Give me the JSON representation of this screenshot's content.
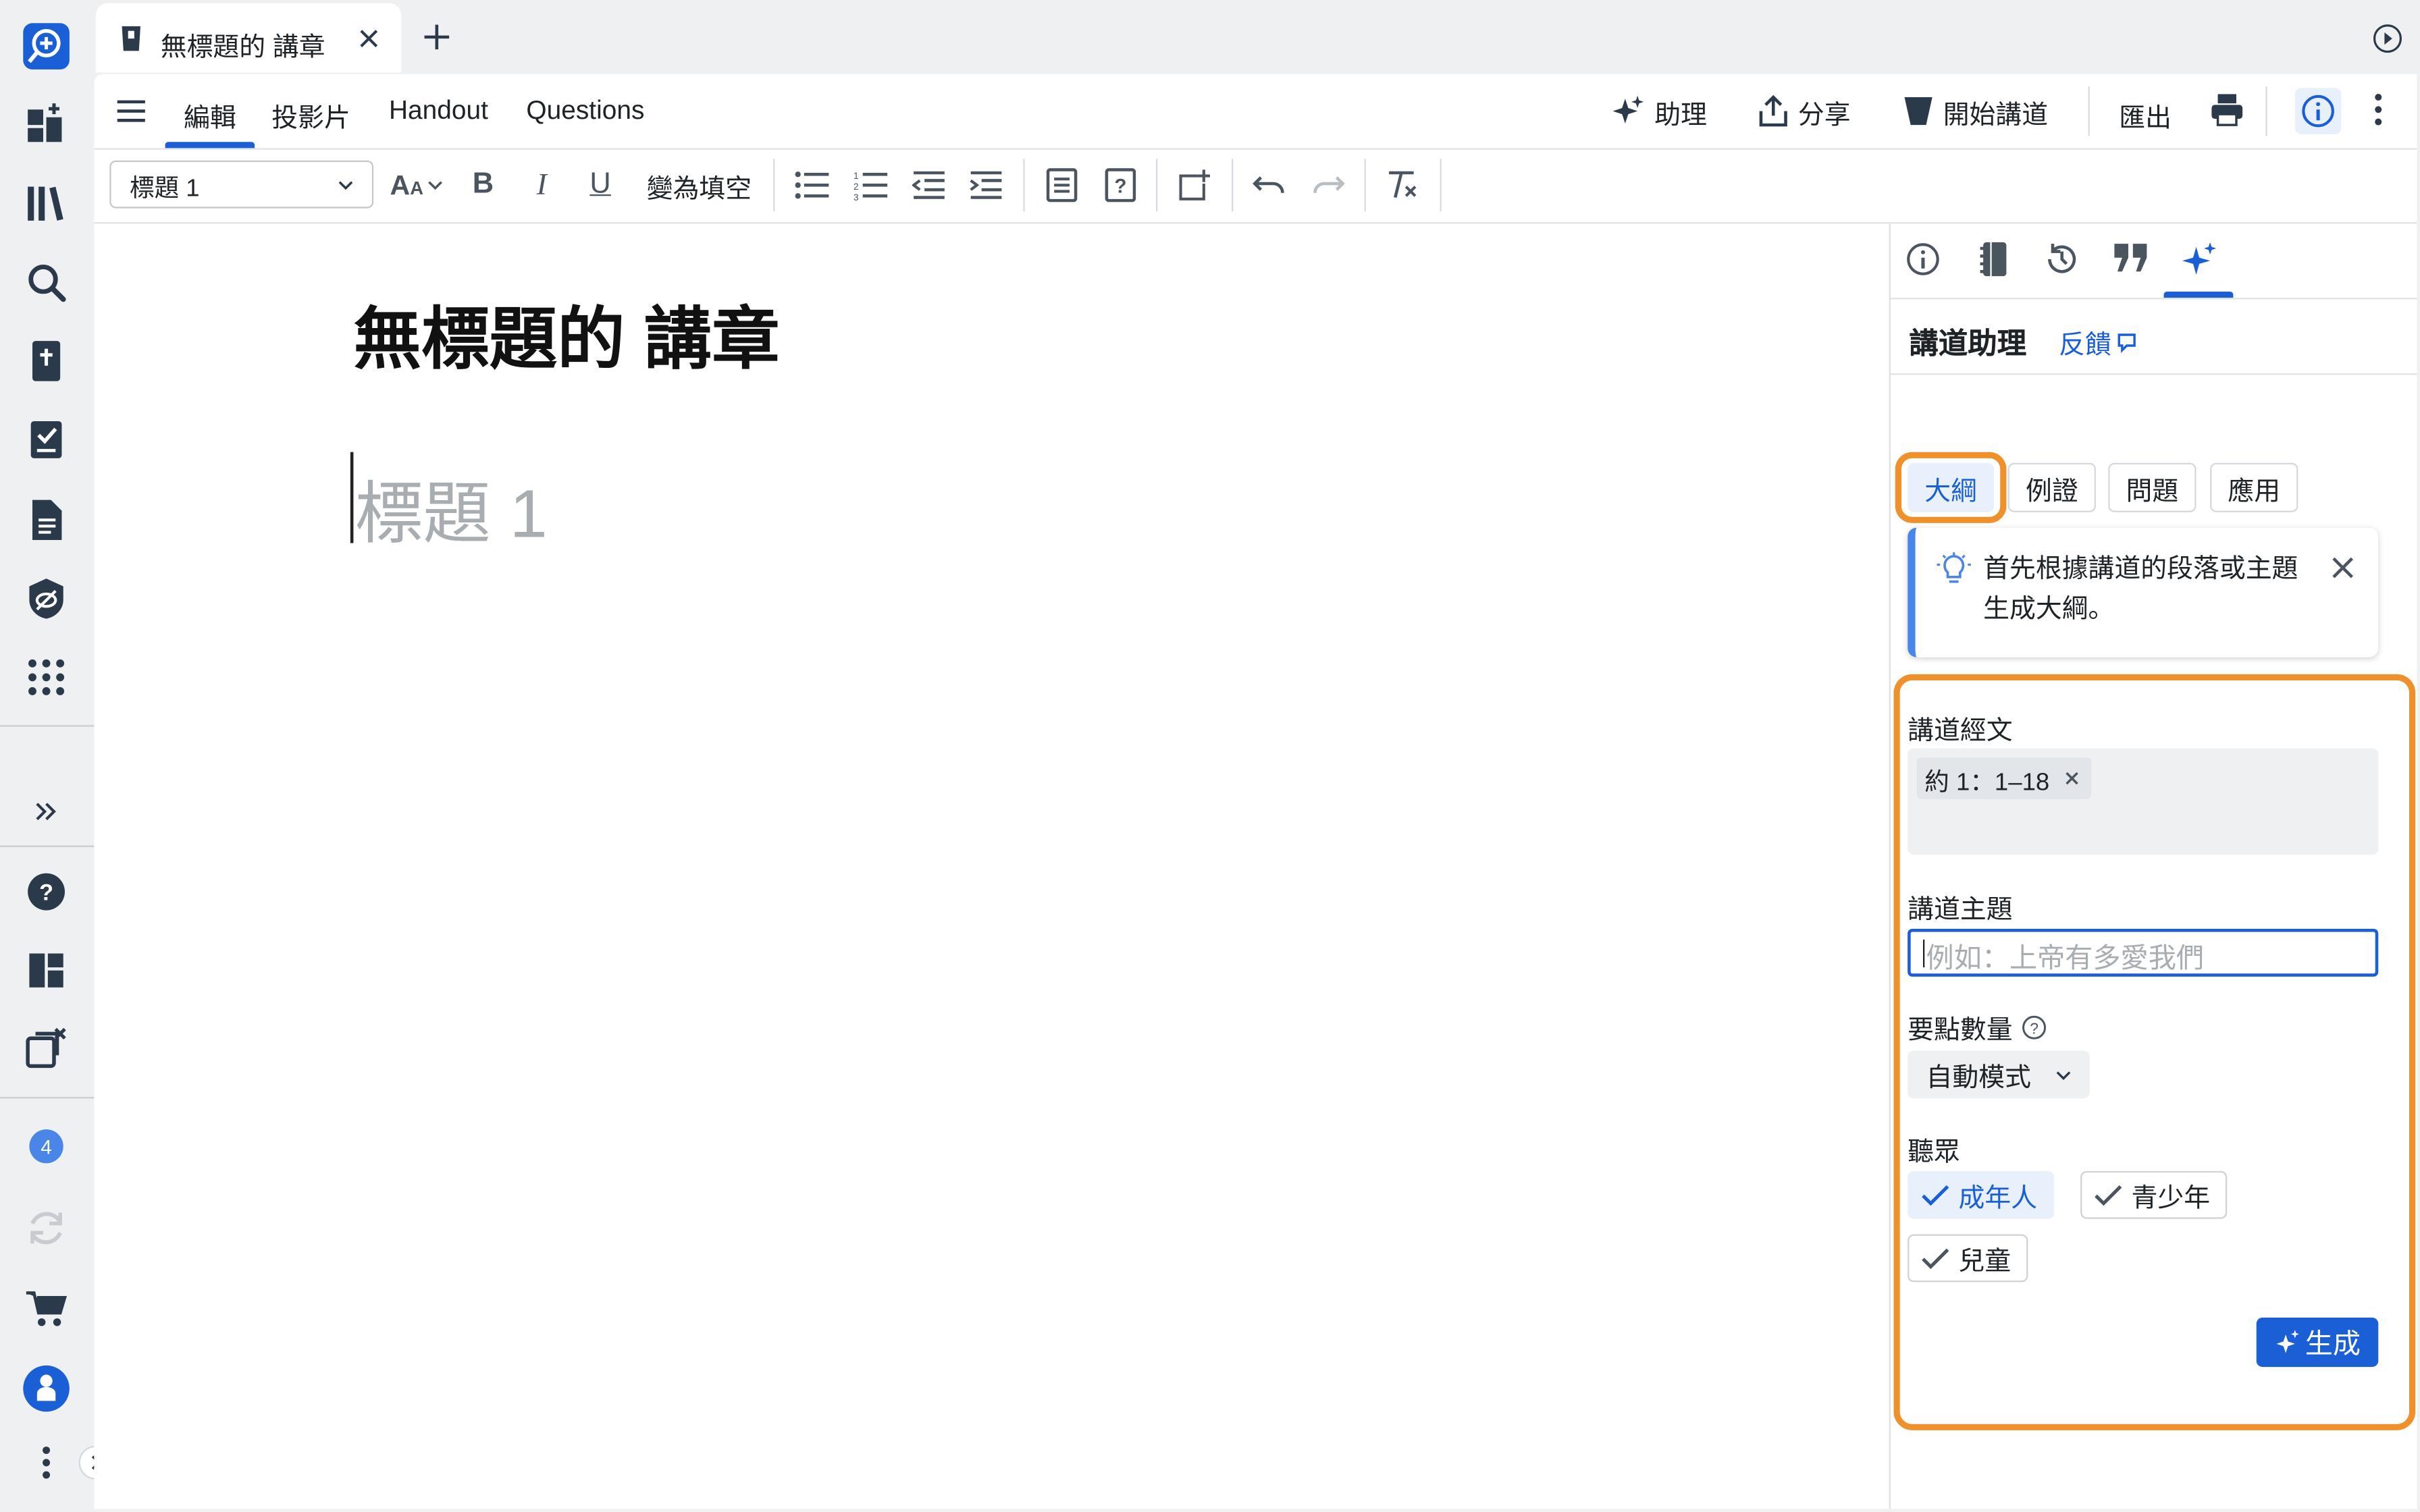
{
  "tab": {
    "title": "無標題的 講章"
  },
  "menu": {
    "items": [
      "編輯",
      "投影片",
      "Handout",
      "Questions"
    ],
    "active": "編輯"
  },
  "right_actions": {
    "assistant": "助理",
    "share": "分享",
    "start_preaching": "開始講道",
    "export": "匯出"
  },
  "toolbar": {
    "style_select": "標題 1",
    "cloze": "變為填空"
  },
  "editor": {
    "title": "無標題的 講章",
    "heading_placeholder": "標題 1"
  },
  "assistant": {
    "title": "講道助理",
    "feedback": "反饋",
    "tabs": [
      "大綱",
      "例證",
      "問題",
      "應用"
    ],
    "active_tab": "大綱",
    "tip": "首先根據講道的段落或主題生成大綱。",
    "passage_label": "講道經文",
    "passage_tag": "約 1：1–18",
    "theme_label": "講道主題",
    "theme_placeholder": "例如：上帝有多愛我們",
    "points_label": "要點數量",
    "points_value": "自動模式",
    "audience_label": "聽眾",
    "audience": [
      {
        "label": "成年人",
        "selected": true
      },
      {
        "label": "青少年",
        "selected": false
      },
      {
        "label": "兒童",
        "selected": false
      }
    ],
    "generate": "生成"
  },
  "sidebar": {
    "badge": "4"
  },
  "colors": {
    "accent": "#1a5fd6",
    "highlight": "#f0902a",
    "selected_bg": "#e8f0fc"
  }
}
